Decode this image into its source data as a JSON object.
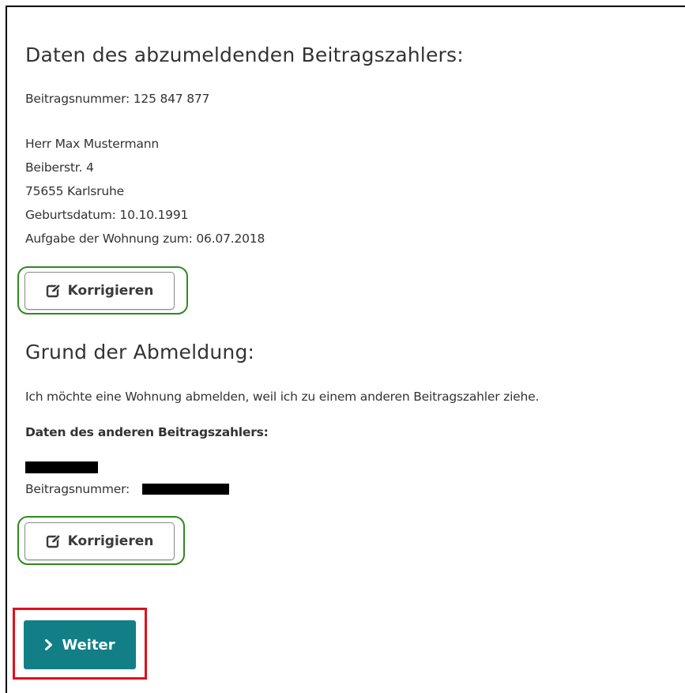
{
  "section1": {
    "heading": "Daten des abzumeldenden Beitragszahlers:",
    "beitragsnummer_line": "Beitragsnummer: 125 847 877",
    "address_lines": [
      "Herr Max Mustermann",
      "Beiberstr. 4",
      "75655 Karlsruhe",
      "Geburtsdatum: 10.10.1991",
      "Aufgabe der Wohnung zum: 06.07.2018"
    ],
    "edit_label": "Korrigieren"
  },
  "section2": {
    "heading": "Grund der Abmeldung:",
    "reason": "Ich möchte eine Wohnung abmelden, weil ich zu einem anderen Beitragszahler ziehe.",
    "subheading": "Daten des anderen Beitragszahlers:",
    "beitragsnummer_label": "Beitragsnummer: ",
    "edit_label": "Korrigieren"
  },
  "actions": {
    "next_label": "Weiter"
  },
  "colors": {
    "primary_button": "#127f87",
    "highlight_green": "#2f8a1f",
    "highlight_red": "#e0101a"
  },
  "icons": {
    "edit": "edit-icon",
    "next": "chevron-right-icon"
  }
}
